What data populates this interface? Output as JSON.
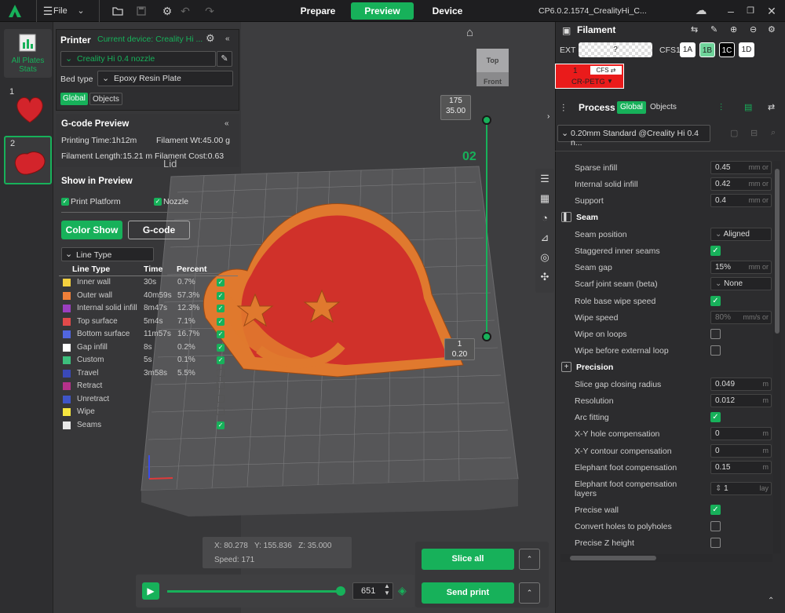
{
  "topbar": {
    "file_label": "File",
    "tabs": [
      "Prepare",
      "Preview",
      "Device"
    ],
    "active_tab": "Preview",
    "project_title": "CP6.0.2.1574_CrealityHi_C..."
  },
  "plates": {
    "all_label": "All Plates Stats",
    "items": [
      {
        "num": "1"
      },
      {
        "num": "2"
      }
    ]
  },
  "printer": {
    "title": "Printer",
    "current_device": "Current device: Creality Hi ...",
    "nozzle": "Creality Hi 0.4 nozzle",
    "bed_type_label": "Bed type",
    "bed_type": "Epoxy Resin Plate",
    "tab_global": "Global",
    "tab_objects": "Objects"
  },
  "gcode_preview": {
    "title": "G-code Preview",
    "printing_time": "Printing Time:1h12m",
    "filament_wt": "Filament Wt:45.00 g",
    "filament_length": "Filament Length:15.21 m",
    "filament_cost": "Filament Cost:0.63",
    "lid_label": "Lid"
  },
  "show_in_preview": {
    "title": "Show in Preview",
    "print_platform": "Print Platform",
    "nozzle": "Nozzle",
    "color_show": "Color Show",
    "gcode": "G-code",
    "line_type_select": "Line Type"
  },
  "line_table": {
    "headers": [
      "Line Type",
      "Time",
      "Percent"
    ],
    "rows": [
      {
        "name": "Inner wall",
        "time": "30s",
        "pct": "0.7%",
        "color": "#f4d03f",
        "checked": true
      },
      {
        "name": "Outer wall",
        "time": "40m59s",
        "pct": "57.3%",
        "color": "#f07f39",
        "checked": true
      },
      {
        "name": "Internal solid infill",
        "time": "8m47s",
        "pct": "12.3%",
        "color": "#9b3fc0",
        "checked": true
      },
      {
        "name": "Top surface",
        "time": "5m4s",
        "pct": "7.1%",
        "color": "#e24a4a",
        "checked": true
      },
      {
        "name": "Bottom surface",
        "time": "11m57s",
        "pct": "16.7%",
        "color": "#5166e0",
        "checked": true
      },
      {
        "name": "Gap infill",
        "time": "8s",
        "pct": "0.2%",
        "color": "#ffffff",
        "checked": true
      },
      {
        "name": "Custom",
        "time": "5s",
        "pct": "0.1%",
        "color": "#3dbf7d",
        "checked": true
      },
      {
        "name": "Travel",
        "time": "3m58s",
        "pct": "5.5%",
        "color": "#3a49b8",
        "checked": false
      },
      {
        "name": "Retract",
        "time": "",
        "pct": "",
        "color": "#b5318a",
        "checked": false
      },
      {
        "name": "Unretract",
        "time": "",
        "pct": "",
        "color": "#3f55c8",
        "checked": false
      },
      {
        "name": "Wipe",
        "time": "",
        "pct": "",
        "color": "#f6e640",
        "checked": false
      },
      {
        "name": "Seams",
        "time": "",
        "pct": "",
        "color": "#e8e8e8",
        "checked": true
      }
    ]
  },
  "viewport": {
    "cube_top": "Top",
    "cube_front": "Front",
    "layer_top_num": "175",
    "layer_top_z": "35.00",
    "layer_bottom_num": "1",
    "layer_bottom_z": "0.20",
    "plate_id": "02",
    "coords": "X: 80.278   Y: 155.836   Z: 35.000",
    "speed": "Speed: 171",
    "layer_count": "651",
    "slider_level": 0.98
  },
  "actions": {
    "slice_all": "Slice all",
    "send_print": "Send print"
  },
  "filament": {
    "title": "Filament",
    "ext_label": "EXT",
    "ext_value": "?",
    "cfs_label": "CFS1",
    "slots": [
      "1A",
      "1B",
      "1C",
      "1D"
    ],
    "active_slot": "1B",
    "spool_num": "1",
    "spool_cfs": "CFS",
    "spool_type": "CR-PETG"
  },
  "process": {
    "title": "Process",
    "tab_global": "Global",
    "tab_objects": "Objects",
    "preset": "0.20mm Standard @Creality Hi 0.4 n..."
  },
  "settings": {
    "sparse_infill": {
      "label": "Sparse infill",
      "value": "0.45",
      "unit": "mm or"
    },
    "internal_solid_infill": {
      "label": "Internal solid infill",
      "value": "0.42",
      "unit": "mm or"
    },
    "support": {
      "label": "Support",
      "value": "0.4",
      "unit": "mm or"
    },
    "seam_section": "Seam",
    "seam_position": {
      "label": "Seam position",
      "value": "Aligned"
    },
    "staggered": {
      "label": "Staggered inner seams"
    },
    "seam_gap": {
      "label": "Seam gap",
      "value": "15%",
      "unit": "mm or"
    },
    "scarf": {
      "label": "Scarf joint seam (beta)",
      "value": "None"
    },
    "role_wipe": {
      "label": "Role base wipe speed"
    },
    "wipe_speed": {
      "label": "Wipe speed",
      "value": "80%",
      "unit": "mm/s or"
    },
    "wipe_loops": {
      "label": "Wipe on loops"
    },
    "wipe_before": {
      "label": "Wipe before external loop"
    },
    "precision_section": "Precision",
    "slice_gap": {
      "label": "Slice gap closing radius",
      "value": "0.049",
      "unit": "m"
    },
    "resolution": {
      "label": "Resolution",
      "value": "0.012",
      "unit": "m"
    },
    "arc_fitting": {
      "label": "Arc fitting"
    },
    "xy_hole": {
      "label": "X-Y hole compensation",
      "value": "0",
      "unit": "m"
    },
    "xy_contour": {
      "label": "X-Y contour compensation",
      "value": "0",
      "unit": "m"
    },
    "elephant": {
      "label": "Elephant foot compensation",
      "value": "0.15",
      "unit": "m"
    },
    "elephant_layers": {
      "label": "Elephant foot compensation layers",
      "value": "1",
      "unit": "lay"
    },
    "precise_wall": {
      "label": "Precise wall"
    },
    "holes_polyholes": {
      "label": "Convert holes to polyholes"
    },
    "precise_z": {
      "label": "Precise Z height"
    }
  },
  "colors": {
    "accent": "#17b15a",
    "model_outer": "#e0792e",
    "model_top": "#d0312a"
  }
}
